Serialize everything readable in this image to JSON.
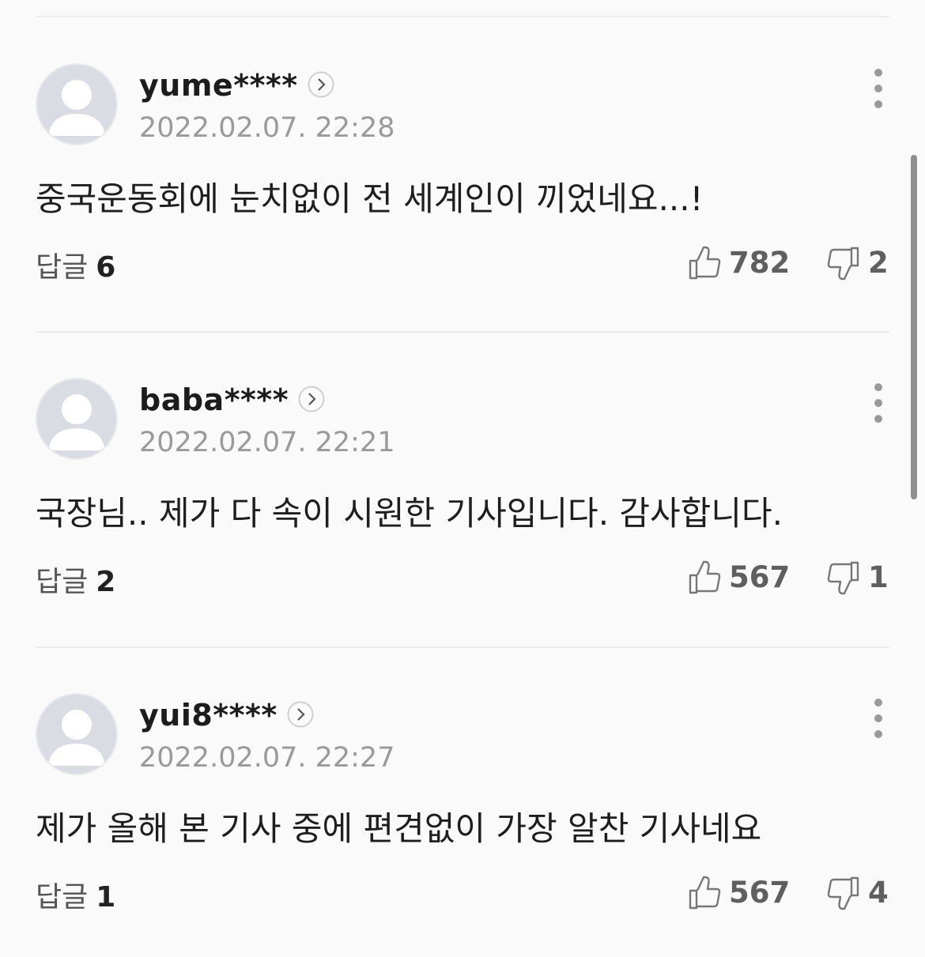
{
  "reply_label": "답글",
  "comments": [
    {
      "username": "yume****",
      "timestamp": "2022.02.07. 22:28",
      "text": "중국운동회에 눈치없이 전 세계인이 끼었네요...!",
      "replies": "6",
      "likes": "782",
      "dislikes": "2"
    },
    {
      "username": "baba****",
      "timestamp": "2022.02.07. 22:21",
      "text": "국장님.. 제가 다 속이 시원한 기사입니다. 감사합니다.",
      "replies": "2",
      "likes": "567",
      "dislikes": "1"
    },
    {
      "username": "yui8****",
      "timestamp": "2022.02.07. 22:27",
      "text": "제가 올해 본 기사 중에 편견없이 가장 알찬 기사네요",
      "replies": "1",
      "likes": "567",
      "dislikes": "4"
    }
  ],
  "icons": {
    "avatar": "default-user-avatar-icon",
    "profile": "chevron-right-icon",
    "more": "more-vertical-icon",
    "like": "thumbs-up-icon",
    "dislike": "thumbs-down-icon"
  },
  "colors": {
    "background": "#fafafa",
    "timestamp": "#9a9a9a",
    "divider": "#ececec"
  }
}
